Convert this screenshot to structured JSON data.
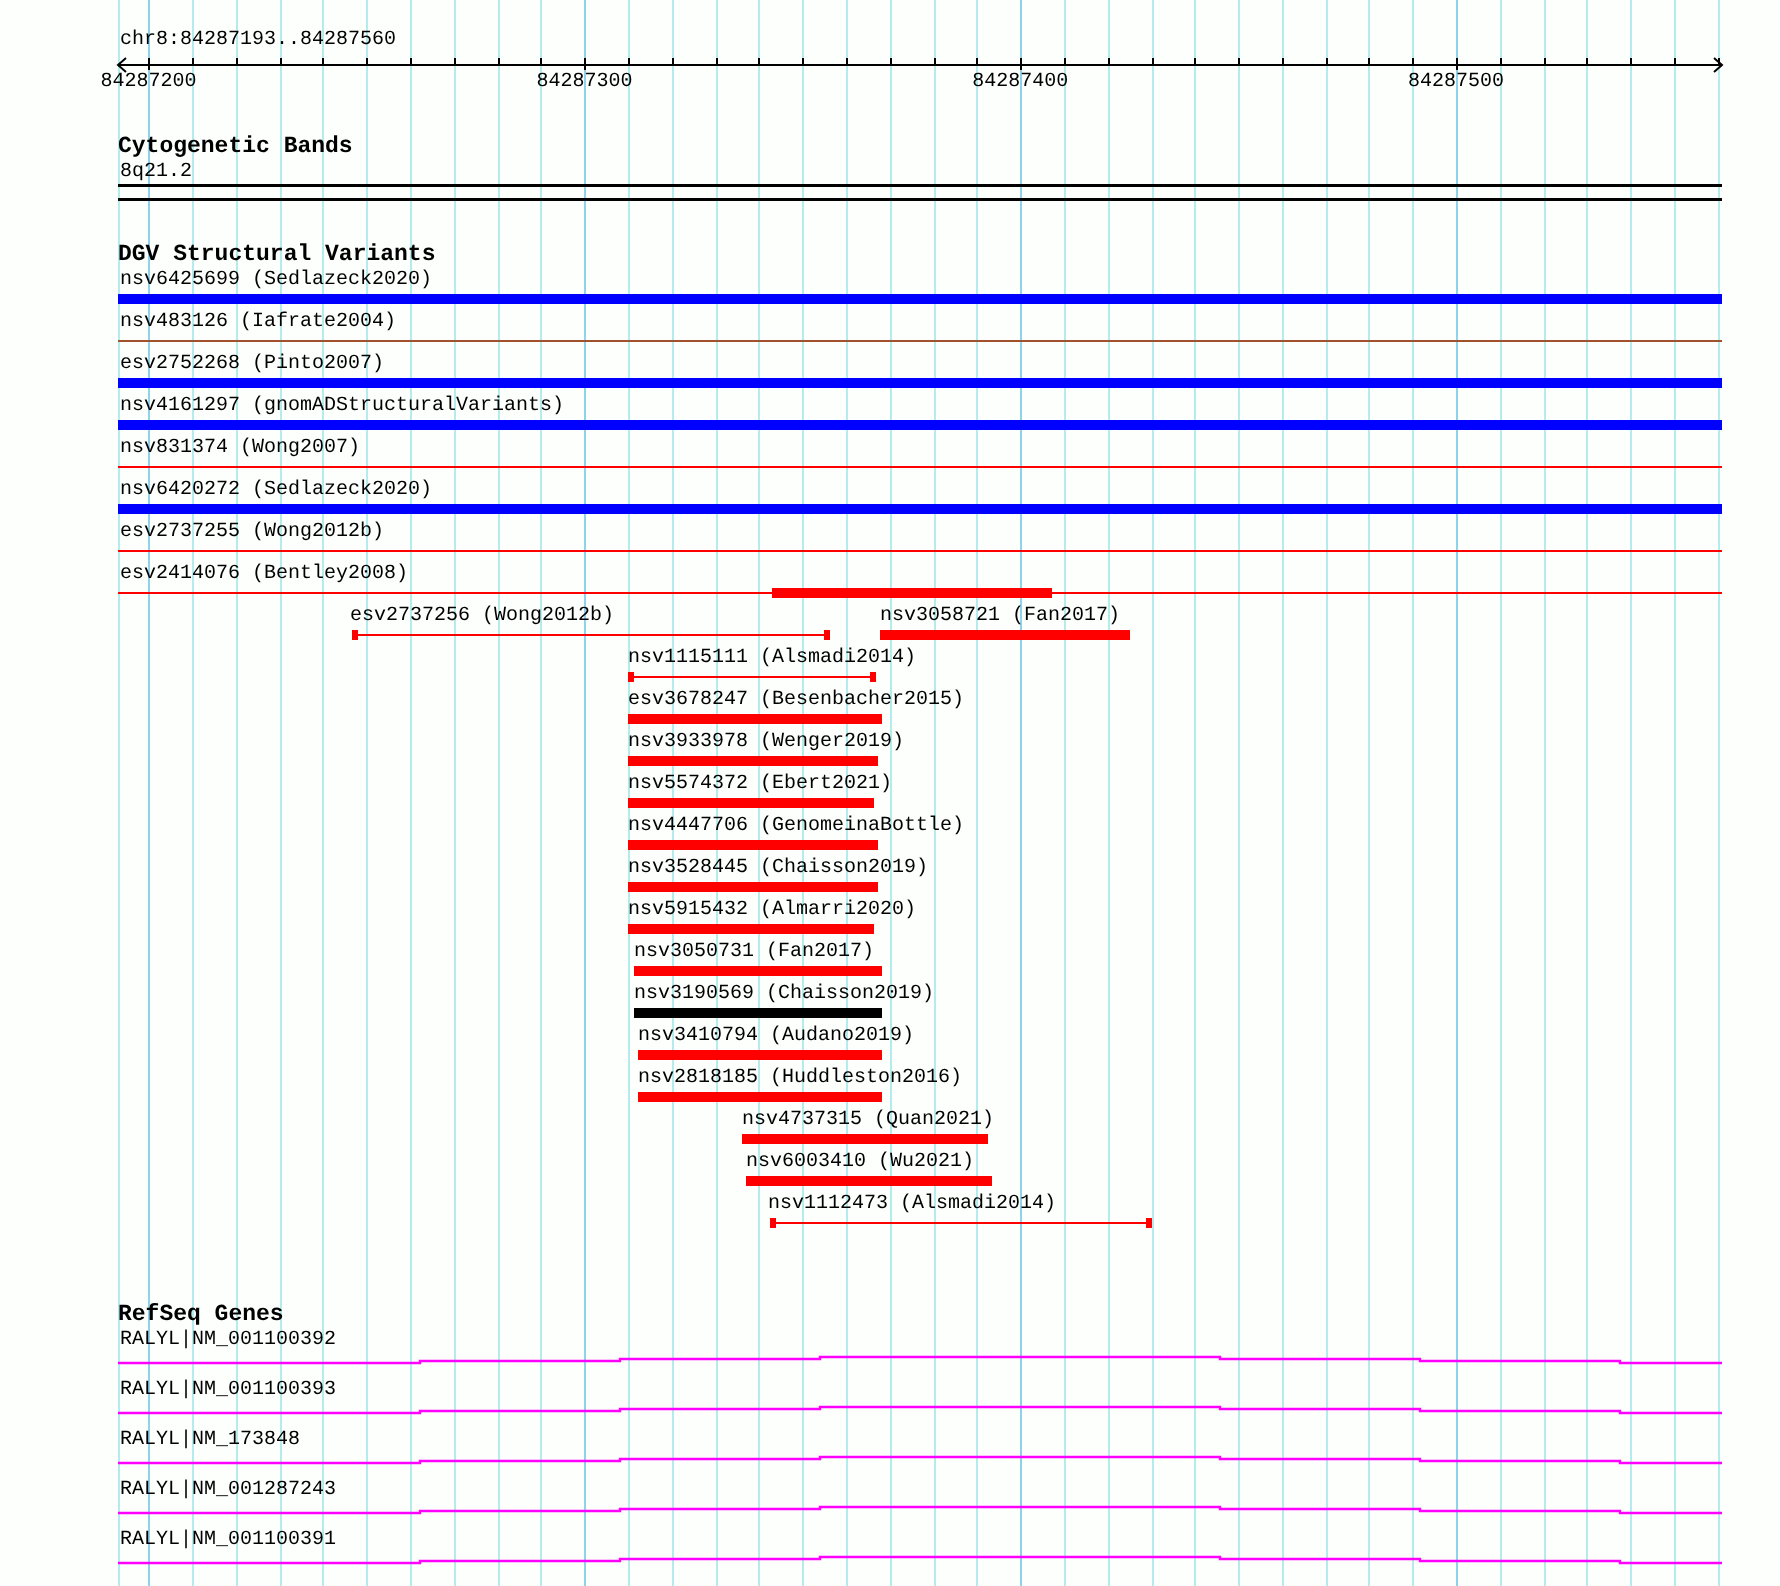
{
  "ruler": {
    "range": "chr8:84287193..84287560",
    "labels": [
      "84287200",
      "84287300",
      "84287400",
      "84287500"
    ]
  },
  "cytogenetic_bands": {
    "title": "Cytogenetic Bands",
    "band": "8q21.2"
  },
  "dgv": {
    "title": "DGV Structural Variants",
    "variants": [
      {
        "label": "nsv6425699 (Sedlazeck2020)",
        "kind": "bar",
        "color": "#0000ff"
      },
      {
        "label": "nsv483126 (Iafrate2004)",
        "kind": "line",
        "color": "#a0522d"
      },
      {
        "label": "esv2752268 (Pinto2007)",
        "kind": "bar",
        "color": "#0000ff"
      },
      {
        "label": "nsv4161297 (gnomADStructuralVariants)",
        "kind": "bar",
        "color": "#0000ff"
      },
      {
        "label": "nsv831374 (Wong2007)",
        "kind": "line",
        "color": "#ff0000"
      },
      {
        "label": "nsv6420272 (Sedlazeck2020)",
        "kind": "bar",
        "color": "#0000ff"
      },
      {
        "label": "esv2737255 (Wong2012b)",
        "kind": "line",
        "color": "#ff0000"
      },
      {
        "label": "esv2414076 (Bentley2008)",
        "kind": "line",
        "color": "#ff0000"
      },
      {
        "kind": "bar",
        "color": "#ff0000"
      },
      {
        "label": "esv2737256 (Wong2012b)",
        "kind": "span",
        "color": "#ff0000"
      },
      {
        "label": "nsv3058721 (Fan2017)",
        "kind": "bar",
        "color": "#ff0000"
      },
      {
        "label": "nsv1115111 (Alsmadi2014)",
        "kind": "span",
        "color": "#ff0000"
      },
      {
        "label": "esv3678247 (Besenbacher2015)",
        "kind": "bar",
        "color": "#ff0000"
      },
      {
        "label": "nsv3933978 (Wenger2019)",
        "kind": "bar",
        "color": "#ff0000"
      },
      {
        "label": "nsv5574372 (Ebert2021)",
        "kind": "bar",
        "color": "#ff0000"
      },
      {
        "label": "nsv4447706 (GenomeinaBottle)",
        "kind": "bar",
        "color": "#ff0000"
      },
      {
        "label": "nsv3528445 (Chaisson2019)",
        "kind": "bar",
        "color": "#ff0000"
      },
      {
        "label": "nsv5915432 (Almarri2020)",
        "kind": "bar",
        "color": "#ff0000"
      },
      {
        "label": "nsv3050731 (Fan2017)",
        "kind": "bar",
        "color": "#ff0000"
      },
      {
        "label": "nsv3190569 (Chaisson2019)",
        "kind": "bar",
        "color": "#000000"
      },
      {
        "label": "nsv3410794 (Audano2019)",
        "kind": "bar",
        "color": "#ff0000"
      },
      {
        "label": "nsv2818185 (Huddleston2016)",
        "kind": "bar",
        "color": "#ff0000"
      },
      {
        "label": "nsv4737315 (Quan2021)",
        "kind": "bar",
        "color": "#ff0000"
      },
      {
        "label": "nsv6003410 (Wu2021)",
        "kind": "bar",
        "color": "#ff0000"
      },
      {
        "label": "nsv1112473 (Alsmadi2014)",
        "kind": "span",
        "color": "#ff0000"
      }
    ]
  },
  "refseq": {
    "title": "RefSeq Genes",
    "genes": [
      {
        "label": "RALYL|NM_001100392"
      },
      {
        "label": "RALYL|NM_001100393"
      },
      {
        "label": "RALYL|NM_173848"
      },
      {
        "label": "RALYL|NM_001287243"
      },
      {
        "label": "RALYL|NM_001100391"
      }
    ]
  }
}
